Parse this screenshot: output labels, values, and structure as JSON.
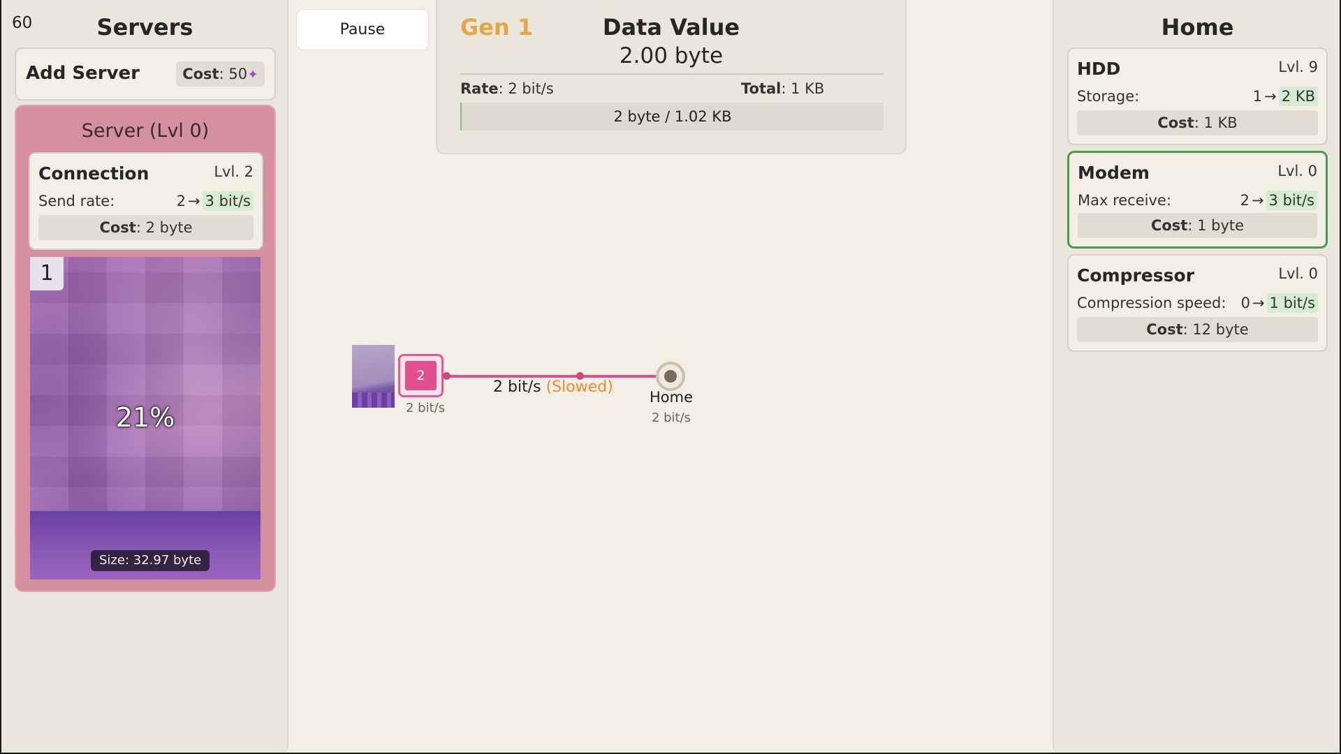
{
  "fps": "60",
  "servers": {
    "title": "Servers",
    "add_server": {
      "label": "Add Server",
      "cost_label": "Cost",
      "cost_value": ": 50",
      "currency_icon": "star-icon"
    },
    "server": {
      "title": "Server (Lvl 0)",
      "connection": {
        "name": "Connection",
        "level": "Lvl. 2",
        "stat_label": "Send rate:",
        "stat_from": "2",
        "stat_to": "3 bit/s",
        "cost_label": "Cost",
        "cost_value": ": 2 byte"
      },
      "badge": "1",
      "progress": "21%",
      "progress_fraction": 0.21,
      "size": "Size: 32.97 byte"
    }
  },
  "controls": {
    "pause_label": "Pause"
  },
  "data_value": {
    "gen": "Gen 1",
    "title": "Data Value",
    "value": "2.00 byte",
    "rate_label": "Rate",
    "rate_value": ": 2 bit/s",
    "total_label": "Total",
    "total_value": ": 1 KB",
    "bar_text": "2 byte / 1.02 KB",
    "bar_fraction": 0.002
  },
  "network": {
    "node_label": "2",
    "node_rate": "2 bit/s",
    "link_rate": "2 bit/s",
    "link_status": "(Slowed)",
    "home_label": "Home",
    "home_rate": "2 bit/s"
  },
  "home": {
    "title": "Home",
    "hdd": {
      "name": "HDD",
      "level": "Lvl. 9",
      "stat_label": "Storage:",
      "stat_from": "1",
      "stat_to": "2 KB",
      "cost_label": "Cost",
      "cost_value": ": 1 KB"
    },
    "modem": {
      "name": "Modem",
      "level": "Lvl. 0",
      "stat_label": "Max receive:",
      "stat_from": "2",
      "stat_to": "3 bit/s",
      "cost_label": "Cost",
      "cost_value": ": 1 byte"
    },
    "compressor": {
      "name": "Compressor",
      "level": "Lvl. 0",
      "stat_label": "Compression speed:",
      "stat_from": "0",
      "stat_to": "1 bit/s",
      "cost_label": "Cost",
      "cost_value": ": 12 byte"
    }
  },
  "colors": {
    "accent_pink": "#e0508e",
    "gen_gold": "#e1a74a",
    "slowed_orange": "#f08a30",
    "upgrade_green": "#d5ecd3",
    "affordable_border": "#4a9a4e"
  }
}
